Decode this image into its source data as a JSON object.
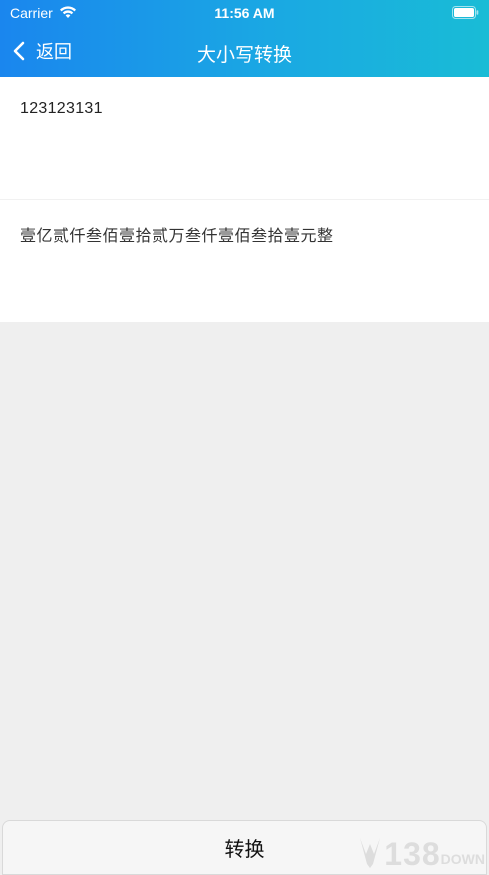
{
  "status_bar": {
    "carrier": "Carrier",
    "time": "11:56 AM",
    "icons": [
      "wifi-icon",
      "battery-icon"
    ]
  },
  "nav": {
    "back_label": "返回",
    "back_icon": "chevron-left-icon",
    "title": "大小写转换"
  },
  "input": {
    "value": "123123131"
  },
  "output": {
    "value": "壹亿贰仟叁佰壹拾贰万叁仟壹佰叁拾壹元整"
  },
  "actions": {
    "convert_label": "转换"
  },
  "watermark": {
    "number": "138",
    "word": "DOWN"
  },
  "colors": {
    "header_start": "#1a86ee",
    "header_end": "#19bcd6",
    "page_background": "#efefef"
  }
}
